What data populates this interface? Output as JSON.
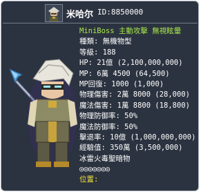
{
  "monster": {
    "name": "米哈尔",
    "id": "ID:8850000",
    "attack_note": "MiniBoss 主動攻擊 無視眩暈",
    "type": "種類: 無機物型",
    "level": "等級: 188",
    "hp": "HP: 21億 (2,100,000,000)",
    "mp": "MP: 6萬 4500 (64,500)",
    "mp_recovery": "MP回復: 1000 (1,000)",
    "phys_damage": "物理傷害: 2萬 8000 (28,000)",
    "magic_damage": "魔法傷害: 1萬 8800 (18,800)",
    "phys_defense": "物理防御率: 50%",
    "magic_defense": "魔法防御率: 50%",
    "knockback": "擊退率: 10億 (1,000,000,000)",
    "exp": "經驗值: 350萬 (3,500,000)",
    "elements": "冰雷火毒聖暗物",
    "element_states": "◎◎◎◎◎◎◎",
    "location": "位置:"
  },
  "colors": {
    "panel_bg": "#2c3340",
    "highlight_green": "#a8e84a",
    "location_yellow": "#f3e23a",
    "text_white": "#ffffff"
  },
  "icons": {
    "avatar": "monster-avatar-icon",
    "sprite": "armored-spear-warrior"
  }
}
